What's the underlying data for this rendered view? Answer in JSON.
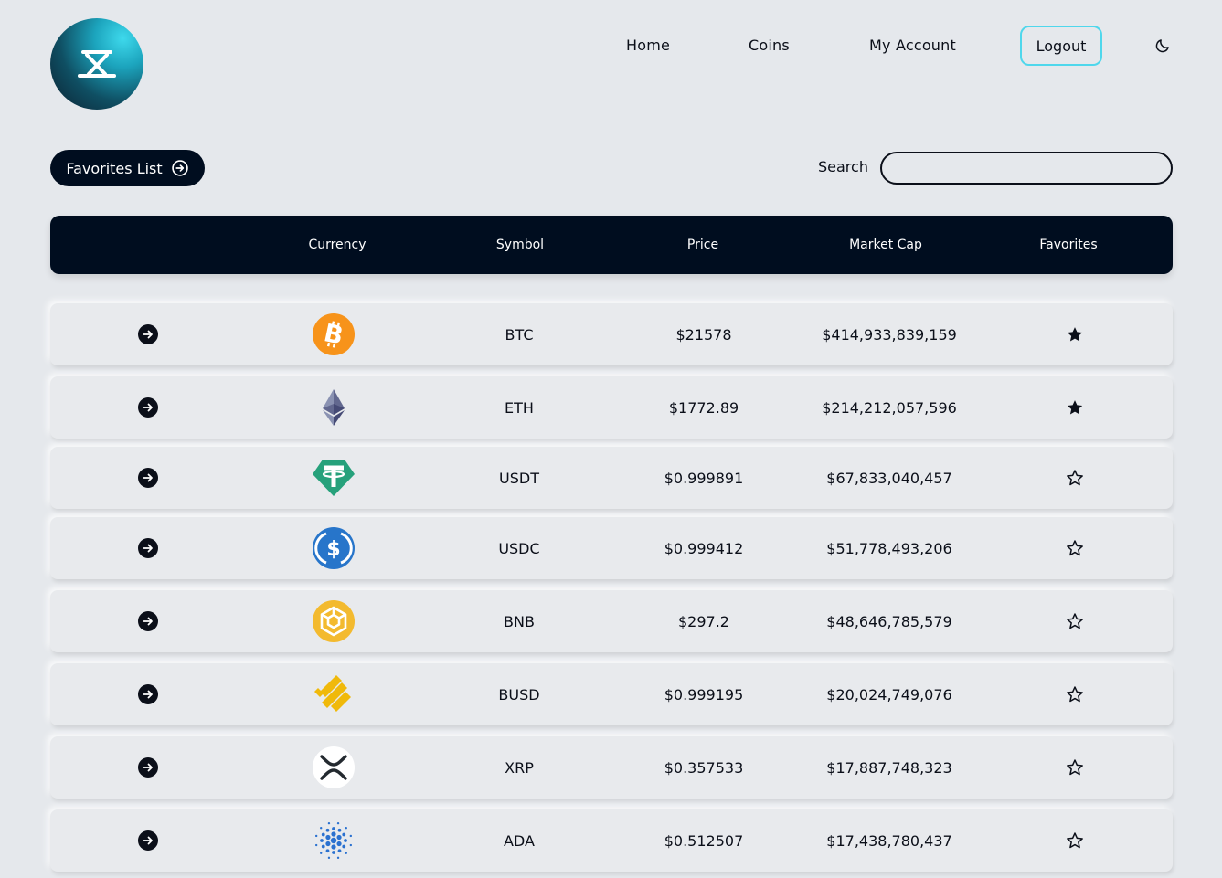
{
  "header": {
    "logo_icon": "app-logo-icon",
    "nav": [
      "Home",
      "Coins",
      "My Account"
    ],
    "logout_label": "Logout",
    "theme_icon": "moon-icon"
  },
  "controls": {
    "favorites_list_label": "Favorites List",
    "favorites_list_icon": "arrow-circle-right-icon",
    "search_label": "Search",
    "search_value": ""
  },
  "table": {
    "columns": [
      "",
      "Currency",
      "Symbol",
      "Price",
      "Market Cap",
      "Favorites"
    ],
    "rows": [
      {
        "icon": "bitcoin-icon",
        "symbol": "BTC",
        "price": "$21578",
        "market_cap": "$414,933,839,159",
        "favorite": true
      },
      {
        "icon": "ethereum-icon",
        "symbol": "ETH",
        "price": "$1772.89",
        "market_cap": "$214,212,057,596",
        "favorite": true
      },
      {
        "icon": "tether-icon",
        "symbol": "USDT",
        "price": "$0.999891",
        "market_cap": "$67,833,040,457",
        "favorite": false
      },
      {
        "icon": "usd-coin-icon",
        "symbol": "USDC",
        "price": "$0.999412",
        "market_cap": "$51,778,493,206",
        "favorite": false
      },
      {
        "icon": "bnb-icon",
        "symbol": "BNB",
        "price": "$297.2",
        "market_cap": "$48,646,785,579",
        "favorite": false
      },
      {
        "icon": "binance-usd-icon",
        "symbol": "BUSD",
        "price": "$0.999195",
        "market_cap": "$20,024,749,076",
        "favorite": false
      },
      {
        "icon": "xrp-icon",
        "symbol": "XRP",
        "price": "$0.357533",
        "market_cap": "$17,887,748,323",
        "favorite": false
      },
      {
        "icon": "cardano-icon",
        "symbol": "ADA",
        "price": "$0.512507",
        "market_cap": "$17,438,780,437",
        "favorite": false
      }
    ]
  },
  "colors": {
    "background": "#e5e8ec",
    "dark": "#000d1f",
    "accent": "#4fd7ec"
  }
}
